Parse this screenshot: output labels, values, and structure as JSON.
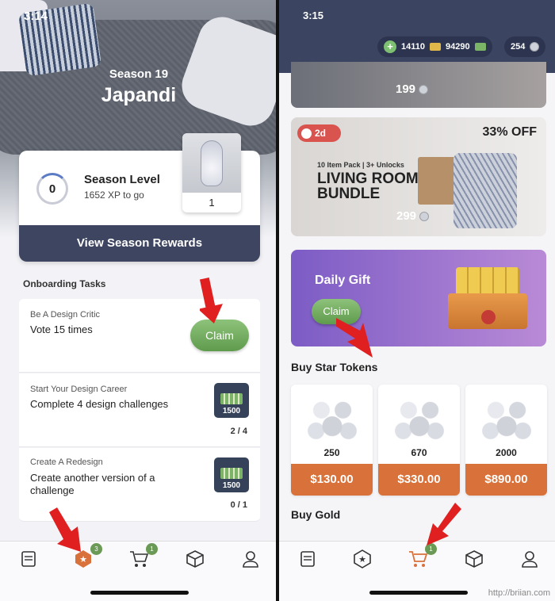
{
  "left": {
    "status_time": "3:14",
    "season_label": "Season 19",
    "season_name": "Japandi",
    "level": {
      "value": "0",
      "title": "Season Level",
      "subtitle": "1652 XP to go"
    },
    "reward_item_count": "1",
    "rewards_button": "View Season Rewards",
    "tasks_header": "Onboarding Tasks",
    "tasks": [
      {
        "category": "Be A Design Critic",
        "description": "Vote 15 times",
        "action": "Claim"
      },
      {
        "category": "Start Your Design Career",
        "description": "Complete 4 design challenges",
        "reward": "1500",
        "progress": "2 / 4"
      },
      {
        "category": "Create A Redesign",
        "description": "Create another version of a challenge",
        "reward": "1500",
        "progress": "0 / 1"
      }
    ],
    "tabbar": {
      "challenges_badge": "3",
      "shop_badge": "1"
    }
  },
  "right": {
    "status_time": "3:15",
    "currency": {
      "cash": "14110",
      "gold": "94290",
      "tokens": "254"
    },
    "top_banner_price": "199",
    "bundle": {
      "timer": "2d",
      "discount": "33% OFF",
      "pack_info": "10 Item Pack | 3+ Unlocks",
      "title": "LIVING ROOM BUNDLE",
      "price": "299"
    },
    "daily_gift": {
      "title": "Daily Gift",
      "action": "Claim"
    },
    "star_tokens_header": "Buy Star Tokens",
    "star_tokens": [
      {
        "amount": "250",
        "price": "$130.00"
      },
      {
        "amount": "670",
        "price": "$330.00"
      },
      {
        "amount": "2000",
        "price": "$890.00"
      }
    ],
    "gold_header": "Buy Gold",
    "tabbar": {
      "shop_badge": "1"
    },
    "watermark": "http://briian.com"
  },
  "colors": {
    "navy": "#3e4560",
    "claim_green": "#6aa257",
    "price_orange": "#d9713a",
    "daily_purple": "#9470cf",
    "arrow_red": "#e02020"
  }
}
